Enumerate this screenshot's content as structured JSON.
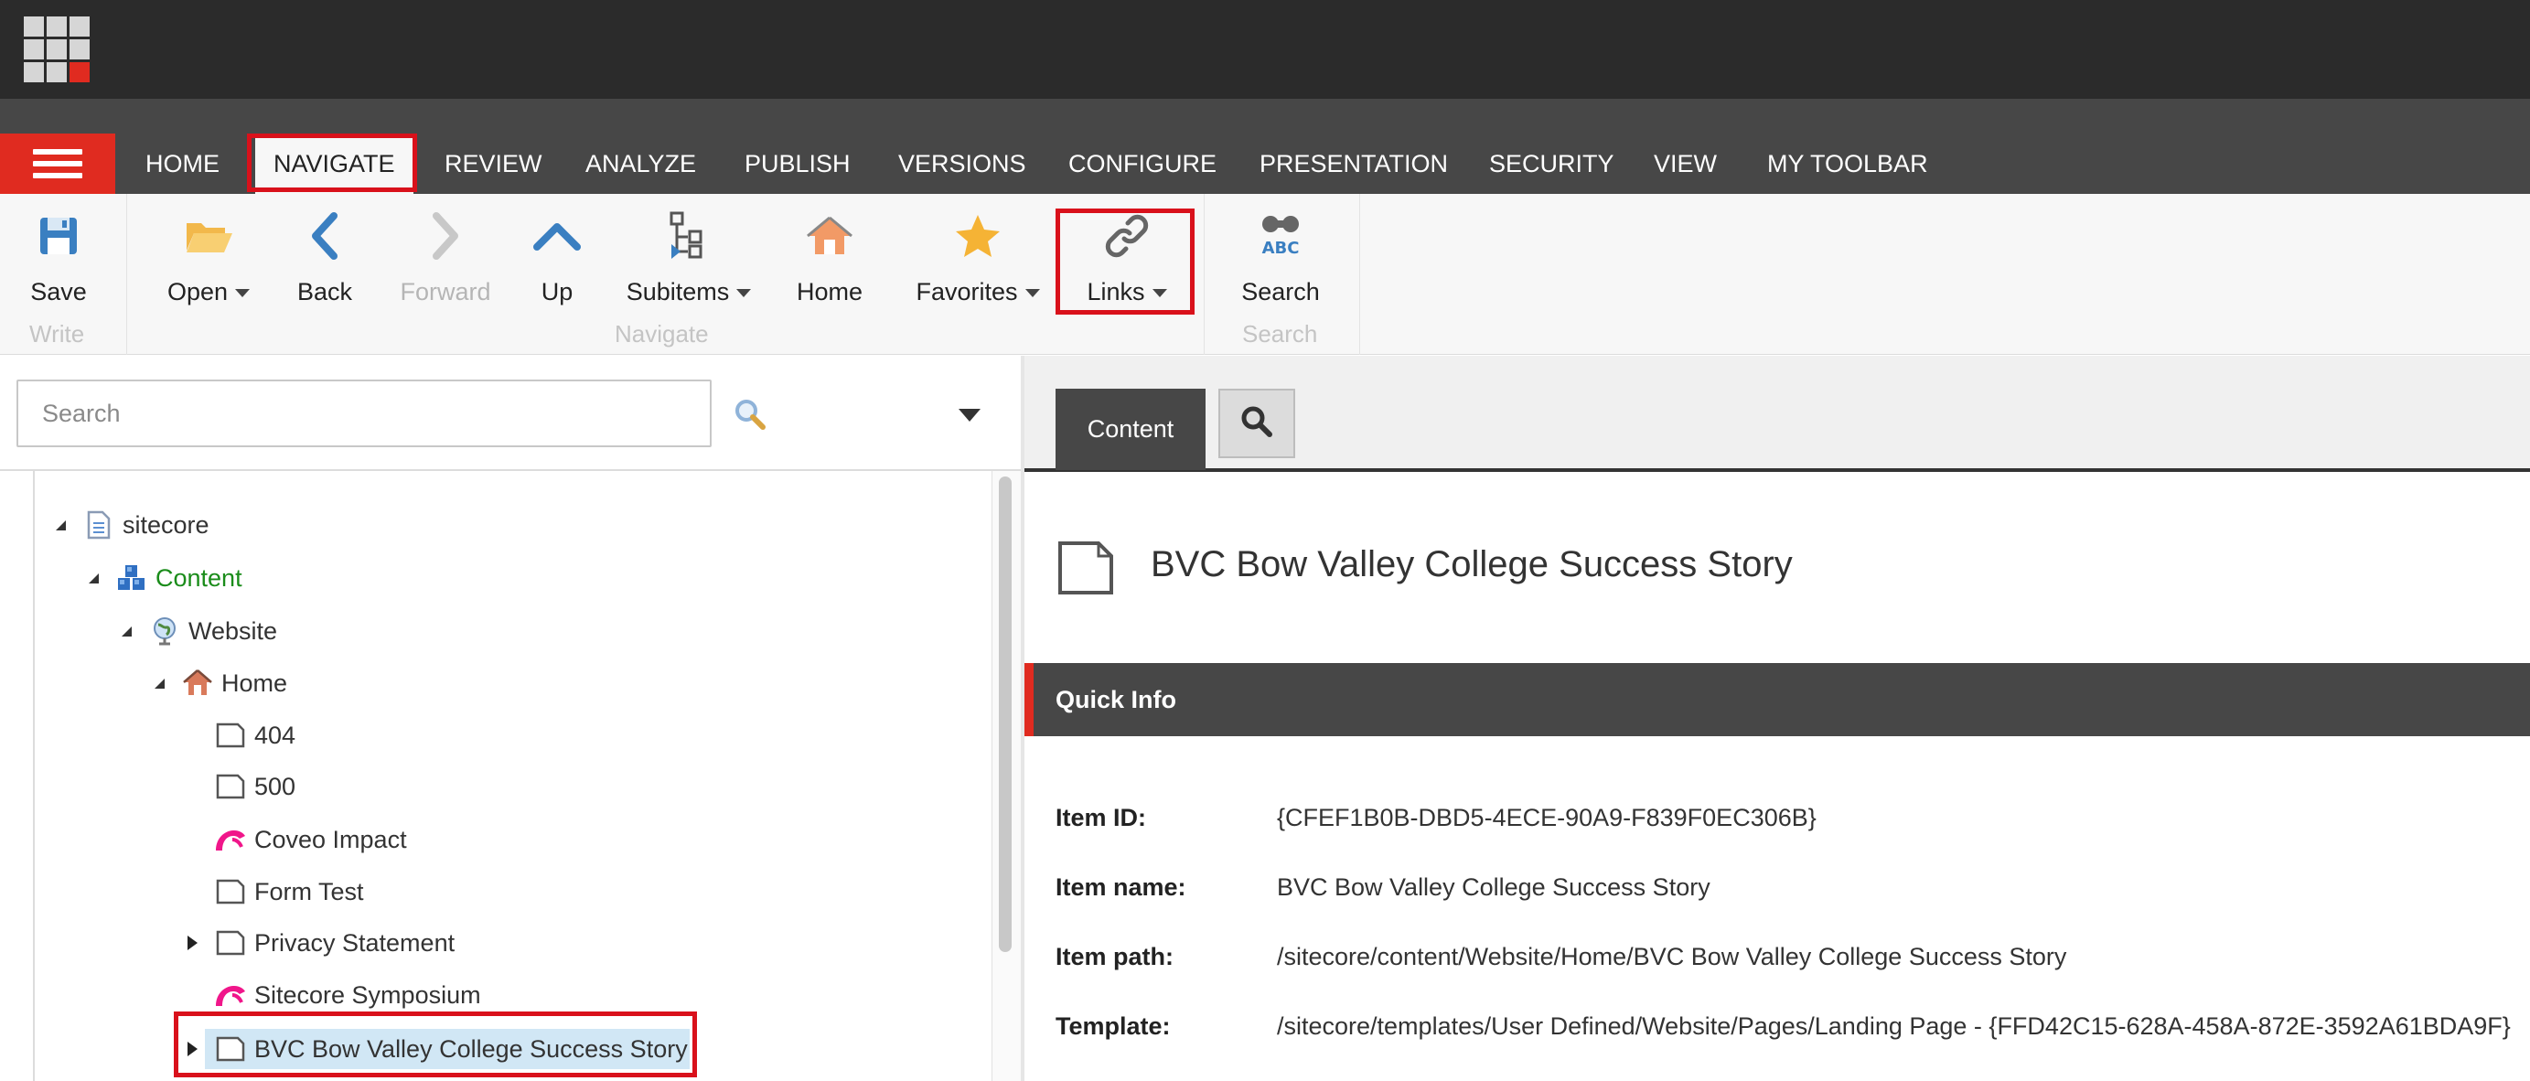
{
  "ribbon_tabs": [
    "HOME",
    "NAVIGATE",
    "REVIEW",
    "ANALYZE",
    "PUBLISH",
    "VERSIONS",
    "CONFIGURE",
    "PRESENTATION",
    "SECURITY",
    "VIEW",
    "MY TOOLBAR"
  ],
  "active_tab": "NAVIGATE",
  "ribbon": {
    "write": {
      "save": "Save",
      "group": "Write"
    },
    "navigate": {
      "open": "Open",
      "back": "Back",
      "forward": "Forward",
      "up": "Up",
      "subitems": "Subitems",
      "home": "Home",
      "favorites": "Favorites",
      "links": "Links",
      "group": "Navigate"
    },
    "search": {
      "search": "Search",
      "group": "Search"
    }
  },
  "tree_search": {
    "placeholder": "Search"
  },
  "tree": {
    "sitecore": "sitecore",
    "content": "Content",
    "website": "Website",
    "home": "Home",
    "n404": "404",
    "n500": "500",
    "coveo": "Coveo Impact",
    "formtest": "Form Test",
    "privacy": "Privacy Statement",
    "symposium": "Sitecore Symposium",
    "bvc": "BVC Bow Valley College Success Story"
  },
  "editor": {
    "content_tab": "Content",
    "item_title": "BVC Bow Valley College Success Story",
    "quick_info": "Quick Info",
    "fields": [
      {
        "label": "Item ID:",
        "value": "{CFEF1B0B-DBD5-4ECE-90A9-F839F0EC306B}"
      },
      {
        "label": "Item name:",
        "value": "BVC Bow Valley College Success Story"
      },
      {
        "label": "Item path:",
        "value": "/sitecore/content/Website/Home/BVC Bow Valley College Success Story"
      },
      {
        "label": "Template:",
        "value": "/sitecore/templates/User Defined/Website/Pages/Landing Page - {FFD42C15-628A-458A-872E-3592A61BDA9F}"
      }
    ]
  },
  "colors": {
    "accent_red": "#e02b20",
    "highlight_box": "#d9111b",
    "tab_dark": "#474747",
    "content_green": "#1a8c1a"
  }
}
